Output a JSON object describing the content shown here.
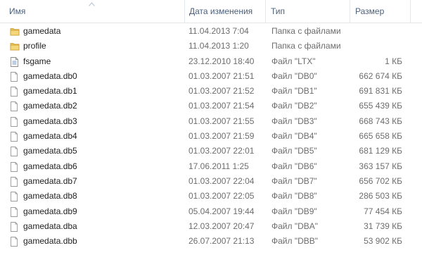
{
  "columns": {
    "name": "Имя",
    "date": "Дата изменения",
    "type": "Тип",
    "size": "Размер"
  },
  "colors": {
    "header_text": "#4c607a",
    "folder": "#e9c35a",
    "sort_arrow": "#b8c8dc"
  },
  "files": [
    {
      "name": "gamedata",
      "date": "11.04.2013 7:04",
      "type": "Папка с файлами",
      "size": "",
      "icon": "folder-icon"
    },
    {
      "name": "profile",
      "date": "11.04.2013 1:20",
      "type": "Папка с файлами",
      "size": "",
      "icon": "folder-icon"
    },
    {
      "name": "fsgame",
      "date": "23.12.2010 18:40",
      "type": "Файл \"LTX\"",
      "size": "1 КБ",
      "icon": "text-file-icon"
    },
    {
      "name": "gamedata.db0",
      "date": "01.03.2007 21:51",
      "type": "Файл \"DB0\"",
      "size": "662 674 КБ",
      "icon": "file-icon"
    },
    {
      "name": "gamedata.db1",
      "date": "01.03.2007 21:52",
      "type": "Файл \"DB1\"",
      "size": "691 831 КБ",
      "icon": "file-icon"
    },
    {
      "name": "gamedata.db2",
      "date": "01.03.2007 21:54",
      "type": "Файл \"DB2\"",
      "size": "655 439 КБ",
      "icon": "file-icon"
    },
    {
      "name": "gamedata.db3",
      "date": "01.03.2007 21:55",
      "type": "Файл \"DB3\"",
      "size": "668 743 КБ",
      "icon": "file-icon"
    },
    {
      "name": "gamedata.db4",
      "date": "01.03.2007 21:59",
      "type": "Файл \"DB4\"",
      "size": "665 658 КБ",
      "icon": "file-icon"
    },
    {
      "name": "gamedata.db5",
      "date": "01.03.2007 22:01",
      "type": "Файл \"DB5\"",
      "size": "681 129 КБ",
      "icon": "file-icon"
    },
    {
      "name": "gamedata.db6",
      "date": "17.06.2011 1:25",
      "type": "Файл \"DB6\"",
      "size": "363 157 КБ",
      "icon": "file-icon"
    },
    {
      "name": "gamedata.db7",
      "date": "01.03.2007 22:04",
      "type": "Файл \"DB7\"",
      "size": "656 702 КБ",
      "icon": "file-icon"
    },
    {
      "name": "gamedata.db8",
      "date": "01.03.2007 22:05",
      "type": "Файл \"DB8\"",
      "size": "286 503 КБ",
      "icon": "file-icon"
    },
    {
      "name": "gamedata.db9",
      "date": "05.04.2007 19:44",
      "type": "Файл \"DB9\"",
      "size": "77 454 КБ",
      "icon": "file-icon"
    },
    {
      "name": "gamedata.dba",
      "date": "12.03.2007 20:47",
      "type": "Файл \"DBA\"",
      "size": "31 739 КБ",
      "icon": "file-icon"
    },
    {
      "name": "gamedata.dbb",
      "date": "26.07.2007 21:13",
      "type": "Файл \"DBB\"",
      "size": "53 902 КБ",
      "icon": "file-icon"
    }
  ]
}
